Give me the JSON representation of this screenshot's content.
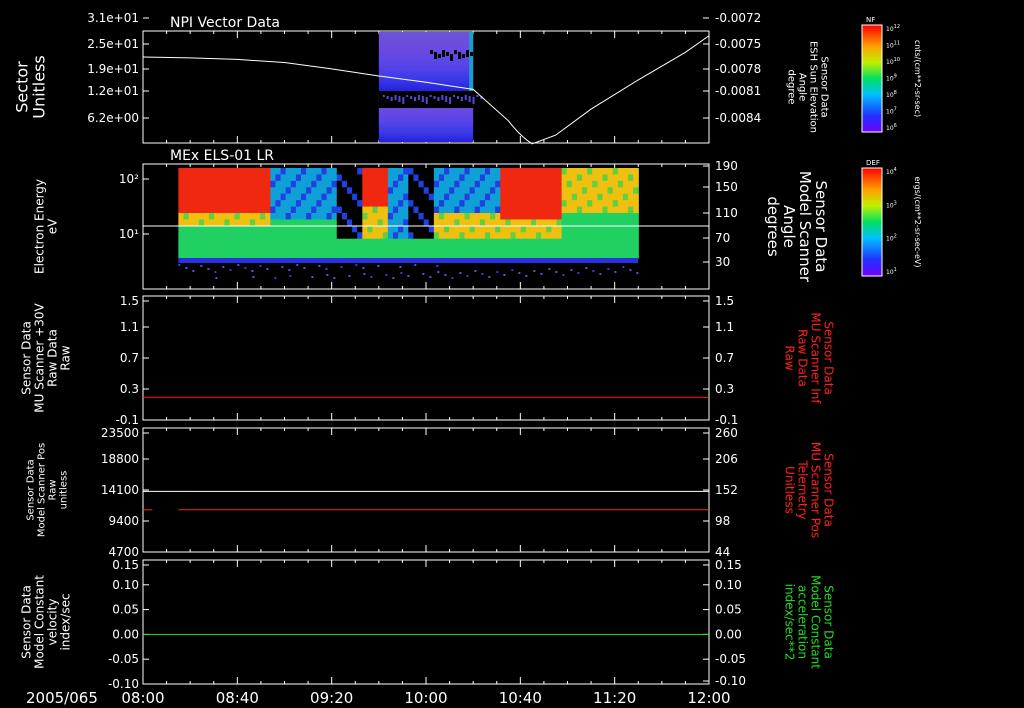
{
  "date_label": "2005/065",
  "time_ticks": [
    "08:00",
    "08:40",
    "09:20",
    "10:00",
    "10:40",
    "11:20",
    "12:00"
  ],
  "colorbars": [
    {
      "tag": "NF",
      "exp_labels": [
        "12",
        "11",
        "10",
        "9",
        "8",
        "7",
        "6"
      ],
      "units": "cnts/(cm**2-sr-sec)"
    },
    {
      "tag": "DEF",
      "exp_labels": [
        "4",
        "3",
        "2",
        "1"
      ],
      "units": "ergs/(cm**2-sr-sec-eV)"
    }
  ],
  "colors": {
    "white": "#ffffff",
    "red": "#ff2020",
    "green": "#22dd22",
    "bg": "#000000"
  },
  "chart_data": [
    {
      "type": "heatmap",
      "title": "NPI Vector Data",
      "ylabel_left": [
        "Sector",
        "Unitless"
      ],
      "left_ticks": [
        "3.1e+01",
        "2.5e+01",
        "1.9e+01",
        "1.2e+01",
        "6.2e+00"
      ],
      "ylabel_right": [
        "Sensor Data",
        "ESH Sun Elevation",
        "Angle",
        "degree"
      ],
      "right_ticks": [
        "-0.0072",
        "-0.0075",
        "-0.0078",
        "-0.0081",
        "-0.0084"
      ],
      "data_time_range": [
        "09:40",
        "10:20"
      ],
      "line": {
        "x": [
          "08:00",
          "08:20",
          "08:40",
          "09:00",
          "09:20",
          "09:40",
          "10:00",
          "10:20",
          "10:35",
          "10:45",
          "10:55",
          "11:10",
          "11:30",
          "11:50",
          "12:00"
        ],
        "y": [
          -0.00749,
          -0.0075,
          -0.00752,
          -0.00756,
          -0.00764,
          -0.00773,
          -0.00781,
          -0.0079,
          -0.0083,
          -0.00859,
          -0.00848,
          -0.00815,
          -0.00778,
          -0.00743,
          -0.00722
        ],
        "ylim": [
          -0.00858,
          -0.00716
        ]
      }
    },
    {
      "type": "heatmap",
      "title": "MEx ELS-01 LR",
      "ylabel_left": [
        "Electron Energy",
        "eV"
      ],
      "left_ticks": [
        "10²",
        "10¹"
      ],
      "ylabel_right": [
        "Sensor Data",
        "Model Scanner",
        "Angle",
        "degrees"
      ],
      "right_ticks": [
        "190",
        "150",
        "110",
        "70",
        "30"
      ],
      "data_time_range": [
        "08:15",
        "11:30"
      ],
      "line": {
        "y": 100,
        "ylim": [
          10,
          190
        ]
      }
    },
    {
      "type": "line",
      "ylabel_left": [
        "Sensor Data",
        "MU Scanner +30V",
        "Raw Data",
        "Raw"
      ],
      "left_ticks": [
        "1.5",
        "1.1",
        "0.7",
        "0.3",
        "-0.1"
      ],
      "ylabel_right": [
        "Sensor Data",
        "MU Scanner Inf",
        "Raw Data",
        "Raw"
      ],
      "right_ticks": [
        "1.5",
        "1.1",
        "0.7",
        "0.3",
        "-0.1"
      ],
      "ylim": [
        -0.35,
        1.5
      ],
      "series": [
        {
          "color": "#ff2020",
          "x": [
            "08:00",
            "12:00"
          ],
          "y": [
            -0.01,
            -0.01
          ]
        }
      ]
    },
    {
      "type": "line",
      "ylabel_left": [
        "Sensor Data",
        "Model Scanner Pos",
        "Raw",
        "unitless"
      ],
      "left_ticks": [
        "23500",
        "18800",
        "14100",
        "9400",
        "4700"
      ],
      "ylabel_right": [
        "Sensor Data",
        "MU Scanner Pos",
        "Telemetry",
        "Unitless"
      ],
      "right_ticks": [
        "260",
        "206",
        "152",
        "98",
        "44"
      ],
      "ylim": [
        0,
        23500
      ],
      "series": [
        {
          "color": "#ffffff",
          "x": [
            "08:00",
            "12:00"
          ],
          "y": [
            11500,
            11500
          ]
        },
        {
          "color": "#ff2020",
          "x": [
            "08:00",
            "08:04"
          ],
          "y": [
            8000,
            8000
          ]
        },
        {
          "color": "#ff2020",
          "x": [
            "08:15",
            "12:00"
          ],
          "y": [
            8000,
            8000
          ]
        }
      ]
    },
    {
      "type": "line",
      "ylabel_left": [
        "Sensor Data",
        "Model Constant",
        "velocity",
        "index/sec"
      ],
      "left_ticks": [
        "0.15",
        "0.10",
        "0.05",
        "0.00",
        "-0.05",
        "-0.10"
      ],
      "ylabel_right": [
        "Sensor Data",
        "Model Constant",
        "acceleration",
        "index/sec**2"
      ],
      "right_ticks": [
        "0.15",
        "0.10",
        "0.05",
        "0.00",
        "-0.05",
        "-0.10"
      ],
      "ylim": [
        -0.1,
        0.15
      ],
      "series": [
        {
          "color": "#22dd22",
          "x": [
            "08:00",
            "12:00"
          ],
          "y": [
            0,
            0
          ]
        }
      ]
    }
  ]
}
